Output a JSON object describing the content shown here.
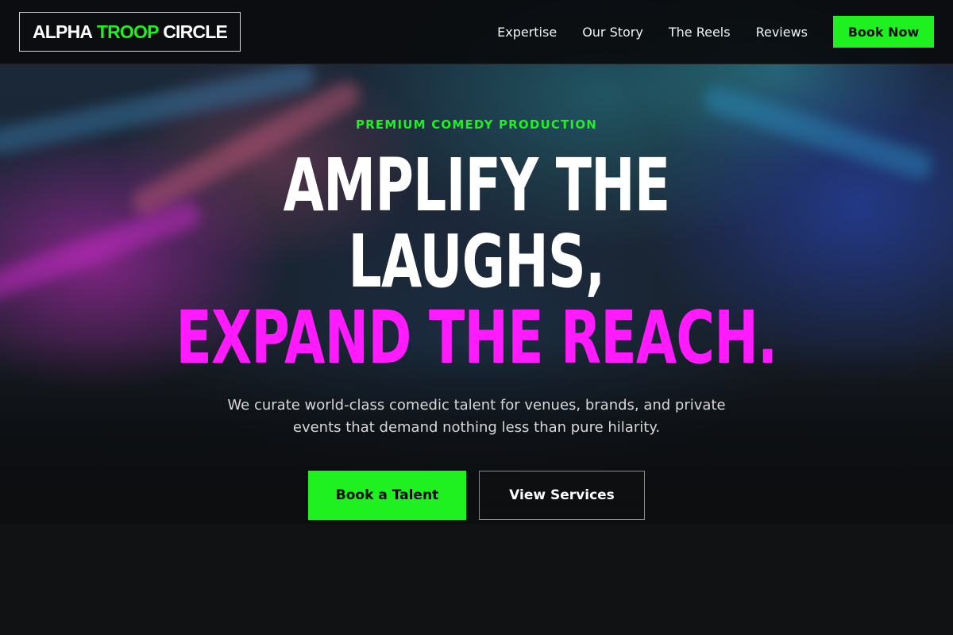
{
  "brand": {
    "name_part1": "ALPHA",
    "name_accent": "TROOP",
    "name_part3": "CIRCLE"
  },
  "nav": {
    "links": [
      "Expertise",
      "Our Story",
      "The Reels",
      "Reviews"
    ],
    "cta_label": "Book Now"
  },
  "hero": {
    "eyebrow": "PREMIUM COMEDY PRODUCTION",
    "headline_line1": "AMPLIFY THE",
    "headline_line2": "LAUGHS,",
    "headline_line3": "EXPAND THE REACH.",
    "subtitle": "We curate world-class comedic talent for venues, brands, and private events that demand nothing less than pure hilarity.",
    "primary_cta": "Book a Talent",
    "secondary_cta": "View Services"
  },
  "colors": {
    "accent_green": "#1ff01f",
    "accent_pink": "#ff1aff",
    "background": "#111214"
  }
}
